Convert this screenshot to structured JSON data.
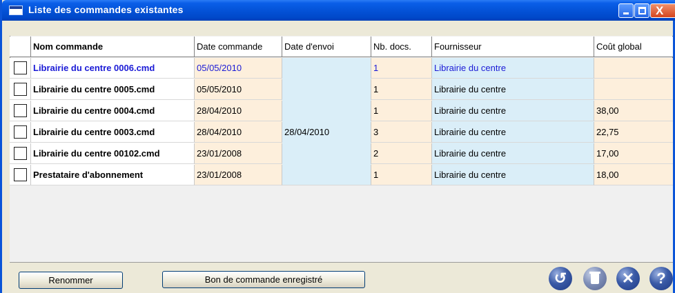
{
  "window": {
    "title": "Liste des commandes existantes",
    "close_glyph": "X"
  },
  "table": {
    "columns": [
      "Nom commande",
      "Date commande",
      "Date d'envoi",
      "Nb. docs.",
      "Fournisseur",
      "Coût global"
    ],
    "rows": [
      {
        "name": "Librairie du centre 0006.cmd",
        "date_commande": "05/05/2010",
        "date_envoi": "",
        "nb_docs": "1",
        "fournisseur": "Librairie du centre",
        "cout": "",
        "selected": true
      },
      {
        "name": "Librairie du centre 0005.cmd",
        "date_commande": "05/05/2010",
        "date_envoi": "",
        "nb_docs": "1",
        "fournisseur": "Librairie du centre",
        "cout": "",
        "selected": false
      },
      {
        "name": "Librairie du centre 0004.cmd",
        "date_commande": "28/04/2010",
        "date_envoi": "",
        "nb_docs": "1",
        "fournisseur": "Librairie du centre",
        "cout": "38,00",
        "selected": false
      },
      {
        "name": "Librairie du centre 0003.cmd",
        "date_commande": "28/04/2010",
        "date_envoi": "28/04/2010",
        "nb_docs": "3",
        "fournisseur": "Librairie du centre",
        "cout": "22,75",
        "selected": false
      },
      {
        "name": "Librairie du centre 00102.cmd",
        "date_commande": "23/01/2008",
        "date_envoi": "",
        "nb_docs": "2",
        "fournisseur": "Librairie du centre",
        "cout": "17,00",
        "selected": false
      },
      {
        "name": "Prestataire d'abonnement",
        "date_commande": "23/01/2008",
        "date_envoi": "",
        "nb_docs": "1",
        "fournisseur": "Librairie du centre",
        "cout": "18,00",
        "selected": false
      }
    ]
  },
  "buttons": {
    "rename": "Renommer",
    "bon": "Bon de commande enregistré"
  },
  "icons": {
    "undo": "↺",
    "cancel": "✕",
    "help": "?"
  },
  "colors": {
    "title_bar": "#0453d8",
    "column_tint_orange": "#fdefdc",
    "column_tint_blue": "#daeef8",
    "selected_text": "#1a1ad6"
  }
}
